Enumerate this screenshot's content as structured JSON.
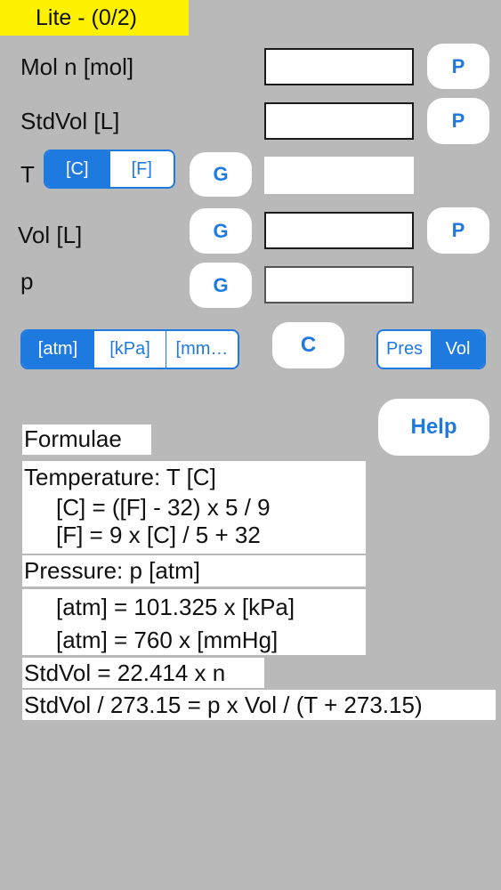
{
  "badge": "Lite - (0/2)",
  "rows": {
    "mol_label": "Mol   n [mol]",
    "stdvol_label": "StdVol   [L]",
    "t_label": "T",
    "vol_label": "Vol   [L]",
    "p_label": "p"
  },
  "temp_unit": {
    "options": [
      "[C]",
      "[F]"
    ],
    "selected": "[C]"
  },
  "pressure_unit": {
    "options": [
      "[atm]",
      "[kPa]",
      "[mm…"
    ],
    "selected": "[atm]"
  },
  "mode": {
    "options": [
      "Pres",
      "Vol"
    ],
    "selected": "Vol"
  },
  "buttons": {
    "p": "P",
    "g": "G",
    "c": "C",
    "help": "Help"
  },
  "formulae": {
    "title": "Formulae",
    "temp_header": "Temperature:  T [C]",
    "temp_line1": "[C] = ([F] - 32) x 5 / 9",
    "temp_line2": "[F] = 9 x [C] / 5 + 32",
    "pres_header": "Pressure:  p [atm]",
    "pres_line1": "[atm] = 101.325 x [kPa]",
    "pres_line2": "[atm] = 760 x [mmHg]",
    "std_line1": "StdVol = 22.414 x n",
    "std_line2": "StdVol / 273.15 = p x Vol / (T + 273.15)"
  },
  "colors": {
    "accent": "#1f7ae0",
    "badge": "#fff200",
    "background": "#b9b9b9"
  }
}
